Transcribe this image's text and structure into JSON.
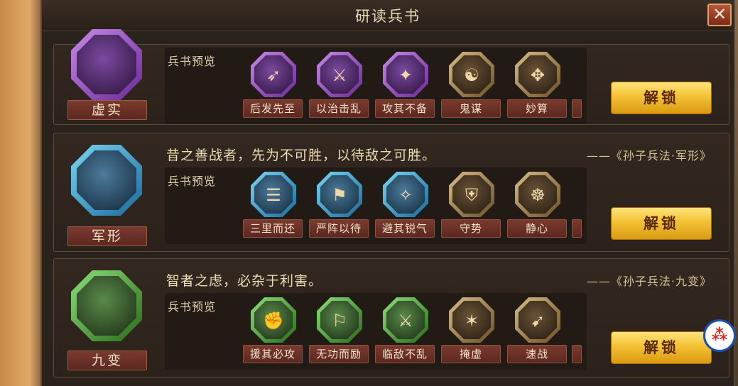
{
  "window": {
    "title": "研读兵书",
    "close_label": "✕"
  },
  "preview_label": "兵书预览",
  "unlock_label": "解锁",
  "colors": {
    "unlock_gold": "#f4c234",
    "plate_red": "#6b3026",
    "purple_frame": "#9a4fc8",
    "blue_frame": "#3aa6d8",
    "green_frame": "#4aa83a",
    "bronze_frame": "#a88a58"
  },
  "cards": [
    {
      "name": "虚实",
      "emblem_icon": "feather-claw-icon",
      "frame": "purple",
      "quote": "",
      "source": "",
      "skills": [
        {
          "label": "后发先至",
          "icon": "purple-dash-icon",
          "frame": "purple",
          "glyph": "➶"
        },
        {
          "label": "以治击乱",
          "icon": "purple-warrior-icon",
          "frame": "purple",
          "glyph": "⚔"
        },
        {
          "label": "攻其不备",
          "icon": "purple-strike-icon",
          "frame": "purple",
          "glyph": "✦"
        },
        {
          "label": "鬼谋",
          "icon": "bronze-strategist-icon",
          "frame": "bronze",
          "glyph": "☯"
        },
        {
          "label": "妙算",
          "icon": "bronze-armor-icon",
          "frame": "bronze",
          "glyph": "✥"
        }
      ]
    },
    {
      "name": "军形",
      "emblem_icon": "shield-arrow-icon",
      "frame": "blue",
      "quote": "昔之善战者，先为不可胜，以待敌之可胜。",
      "source": "——《孙子兵法·军形》",
      "skills": [
        {
          "label": "三里而还",
          "icon": "blue-scroll-icon",
          "frame": "blue",
          "glyph": "☰"
        },
        {
          "label": "严阵以待",
          "icon": "blue-formation-icon",
          "frame": "blue",
          "glyph": "⚑"
        },
        {
          "label": "避其锐气",
          "icon": "blue-evade-icon",
          "frame": "blue",
          "glyph": "✧"
        },
        {
          "label": "守势",
          "icon": "bronze-guard-icon",
          "frame": "bronze",
          "glyph": "⛨"
        },
        {
          "label": "静心",
          "icon": "bronze-meditate-icon",
          "frame": "bronze",
          "glyph": "☸"
        }
      ]
    },
    {
      "name": "九变",
      "emblem_icon": "yin-yang-icon",
      "frame": "green",
      "quote": "智者之虑，必杂于利害。",
      "source": "——《孙子兵法·九变》",
      "skills": [
        {
          "label": "援其必攻",
          "icon": "green-fist-icon",
          "frame": "green",
          "glyph": "✊"
        },
        {
          "label": "无功而励",
          "icon": "green-banner-icon",
          "frame": "green",
          "glyph": "⚐"
        },
        {
          "label": "临敌不乱",
          "icon": "green-sword-icon",
          "frame": "green",
          "glyph": "⚔"
        },
        {
          "label": "掩虚",
          "icon": "bronze-cloak-icon",
          "frame": "bronze",
          "glyph": "✶"
        },
        {
          "label": "速战",
          "icon": "bronze-charge-icon",
          "frame": "bronze",
          "glyph": "➹"
        }
      ]
    }
  ]
}
